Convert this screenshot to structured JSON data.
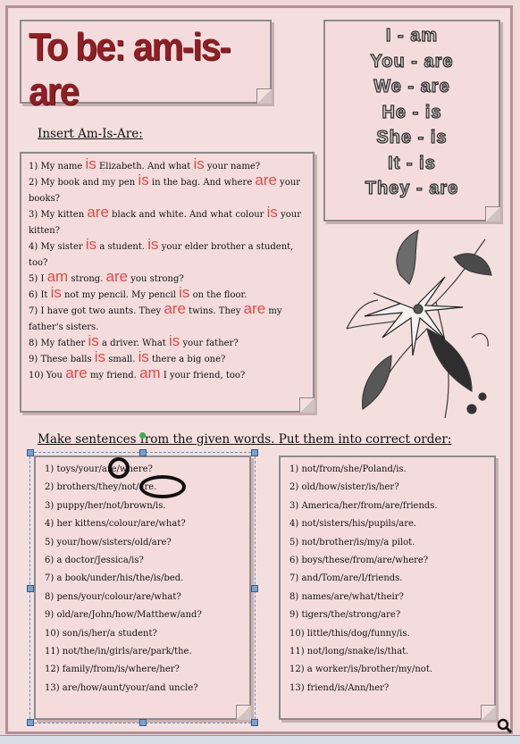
{
  "title": "To be: am-is-are",
  "conjugations": [
    "I - am",
    "You - are",
    "We - are",
    "He - is",
    "She - is",
    "It - is",
    "They - are"
  ],
  "exercise1": {
    "heading": "Insert Am-Is-Are:",
    "lines": [
      [
        "1) My name ",
        {
          "a": "is"
        },
        " Elizabeth. And what ",
        {
          "a": "is"
        },
        " your name?"
      ],
      [
        "2) My book and my pen ",
        {
          "a": "is"
        },
        " in the bag. And where ",
        {
          "a": "are"
        },
        " your books?"
      ],
      [
        "3) My kitten ",
        {
          "a": "are"
        },
        " black and white. And what colour ",
        {
          "a": "is"
        },
        " your kitten?"
      ],
      [
        "4) My sister ",
        {
          "a": "is"
        },
        " a student. ",
        {
          "a": "is"
        },
        " your elder brother a student, too?"
      ],
      [
        "5) I ",
        {
          "a": "am"
        },
        " strong. ",
        {
          "a": "are"
        },
        " you strong?"
      ],
      [
        "6) It ",
        {
          "a": "is"
        },
        " not my pencil. My pencil ",
        {
          "a": "is"
        },
        " on the floor."
      ],
      [
        "7) I have got two aunts. They ",
        {
          "a": "are"
        },
        " twins. They ",
        {
          "a": "are"
        },
        " my father's sisters."
      ],
      [
        "8) My father ",
        {
          "a": "is"
        },
        " a driver. What ",
        {
          "a": "is"
        },
        " your father?"
      ],
      [
        "9) These balls ",
        {
          "a": "is"
        },
        " small. ",
        {
          "a": "is"
        },
        " there a big one?"
      ],
      [
        "10) You ",
        {
          "a": "are"
        },
        " my friend. ",
        {
          "a": "am"
        },
        " I your friend, too?"
      ]
    ]
  },
  "exercise2": {
    "heading": "Make sentences from the given words. Put them into correct order:",
    "left": [
      "1) toys/your/are/where?",
      "2) brothers/they/not/are.",
      "3) puppy/her/not/brown/is.",
      "4) her kittens/colour/are/what?",
      "5) your/how/sisters/old/are?",
      "6) a doctor/Jessica/is?",
      "7) a book/under/his/the/is/bed.",
      "8) pens/your/colour/are/what?",
      "9) old/are/John/how/Matthew/and?",
      "10) son/is/her/a student?",
      "11) not/the/in/girls/are/park/the.",
      "12) family/from/is/where/her?",
      "13) are/how/aunt/your/and  uncle?"
    ],
    "right": [
      "1) not/from/she/Poland/is.",
      "2) old/how/sister/is/her?",
      "3) America/her/from/are/friends.",
      "4) not/sisters/his/pupils/are.",
      "5) not/brother/is/my/a pilot.",
      "6) boys/these/from/are/where?",
      "7) and/Tom/are/I/friends.",
      "8) names/are/what/their?",
      "9) tigers/the/strong/are?",
      "10) little/this/dog/funny/is.",
      "11) not/long/snake/is/that.",
      "12) a worker/is/brother/my/not.",
      "13) friend/is/Ann/her?"
    ]
  },
  "colors": {
    "title": "#8e1f24",
    "answers": "#e04a4a",
    "background": "#f4dfdf"
  },
  "icons": [
    "flower-drawing",
    "zoom-icon"
  ]
}
